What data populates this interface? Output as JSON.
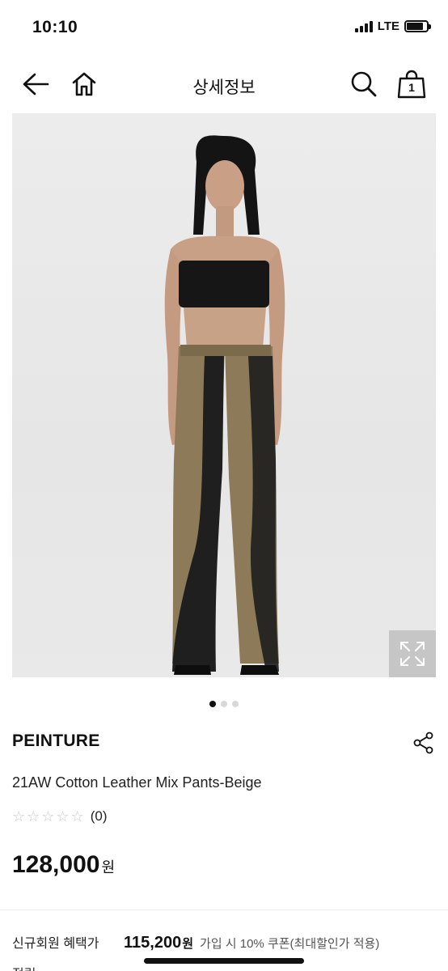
{
  "status_bar": {
    "time": "10:10",
    "network": "LTE"
  },
  "nav": {
    "title": "상세정보",
    "cart_count": "1"
  },
  "gallery": {
    "image_alt": "model wearing strapless black top and two-tone leather flare pants",
    "page_count": 3,
    "active_page": 1
  },
  "product": {
    "brand": "PEINTURE",
    "name": "21AW Cotton Leather Mix Pants-Beige",
    "rating_stars": 0,
    "review_count": "(0)",
    "price": "128,000",
    "price_unit": "원"
  },
  "benefit": {
    "label": "신규회원 혜택가",
    "price": "115,200",
    "unit": "원",
    "note": "가입 시 10% 쿠폰(최대할인가 적용)"
  },
  "cut_row": {
    "label": "적립"
  },
  "colors": {
    "accent": "#111111",
    "star_empty": "#c9c9c9",
    "expand_overlay": "#aaaaaa",
    "pants_beige": "#8d7a58",
    "leather_black": "#1f1f1f"
  },
  "icons": [
    "back-arrow-icon",
    "home-icon",
    "search-icon",
    "shopping-bag-icon",
    "expand-icon",
    "share-icon",
    "star-icon"
  ]
}
